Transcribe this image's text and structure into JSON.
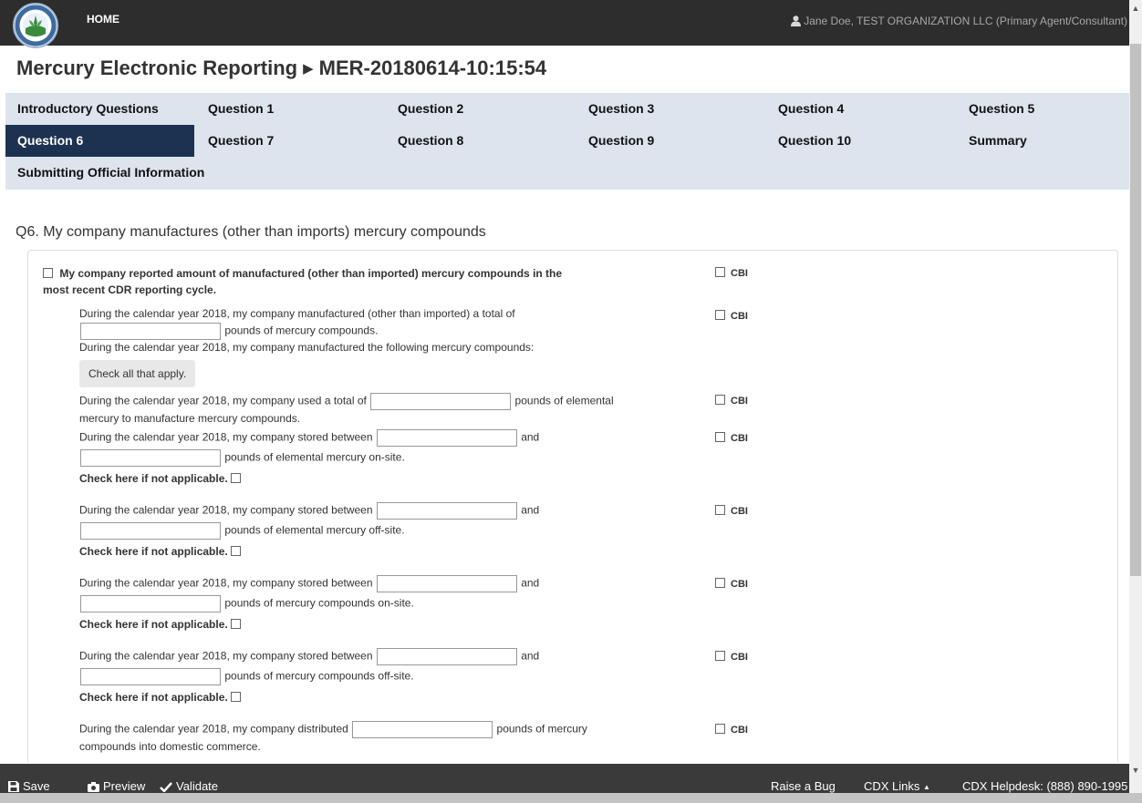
{
  "header": {
    "home_label": "HOME",
    "user_label": "Jane Doe, TEST ORGANIZATION LLC (Primary Agent/Consultant)",
    "logo_icon": "epa-seal-icon",
    "user_icon": "user-icon"
  },
  "page": {
    "title_main": "Mercury Electronic Reporting",
    "title_sep": "▶",
    "title_id": "MER-20180614-10:15:54"
  },
  "nav": {
    "items": [
      {
        "label": "Introductory Questions"
      },
      {
        "label": "Question 1"
      },
      {
        "label": "Question 2"
      },
      {
        "label": "Question 3"
      },
      {
        "label": "Question 4"
      },
      {
        "label": "Question 5"
      },
      {
        "label": "Question 6"
      },
      {
        "label": "Question 7"
      },
      {
        "label": "Question 8"
      },
      {
        "label": "Question 9"
      },
      {
        "label": "Question 10"
      },
      {
        "label": "Summary"
      },
      {
        "label": "Submitting Official Information"
      }
    ],
    "active_label": "Question 6",
    "active_color": "#1c3250",
    "bar_color": "#dde4ee"
  },
  "question": {
    "heading": "Q6. My company manufactures (other than imports) mercury compounds",
    "cbi_label": "CBI",
    "main_checkbox_line1": "My company reported amount of manufactured (other than imported) mercury compounds in the",
    "main_checkbox_line2": "most recent CDR reporting cycle.",
    "manufactured_total_pre": "During the calendar year 2018, my company manufactured (other than imported) a total of",
    "manufactured_total_post": "pounds of mercury compounds.",
    "manufactured_following": "During the calendar year 2018, my company manufactured the following mercury compounds:",
    "check_all": "Check all that apply.",
    "used_pre": "During the calendar year 2018, my company used a total of",
    "used_mid": "pounds of elemental",
    "used_line2": "mercury to manufacture mercury compounds.",
    "stored_pre": "During the calendar year 2018, my company stored between",
    "and_label": "and",
    "stored_elemental_onsite": "pounds of elemental mercury on-site.",
    "stored_elemental_offsite": "pounds of elemental mercury off-site.",
    "stored_compounds_onsite": "pounds of mercury compounds on-site.",
    "stored_compounds_offsite": "pounds of mercury compounds off-site.",
    "not_applicable": "Check here if not applicable.",
    "distributed_pre": "During the calendar year 2018, my company distributed",
    "distributed_mid": "pounds of mercury",
    "distributed_line2": "compounds into domestic commerce."
  },
  "footer": {
    "save_label": "Save",
    "preview_label": "Preview",
    "validate_label": "Validate",
    "raise_bug_label": "Raise a Bug",
    "cdx_links_label": "CDX Links",
    "cdx_links_caret": "▲",
    "helpdesk_label": "CDX Helpdesk: (888) 890-1995"
  }
}
